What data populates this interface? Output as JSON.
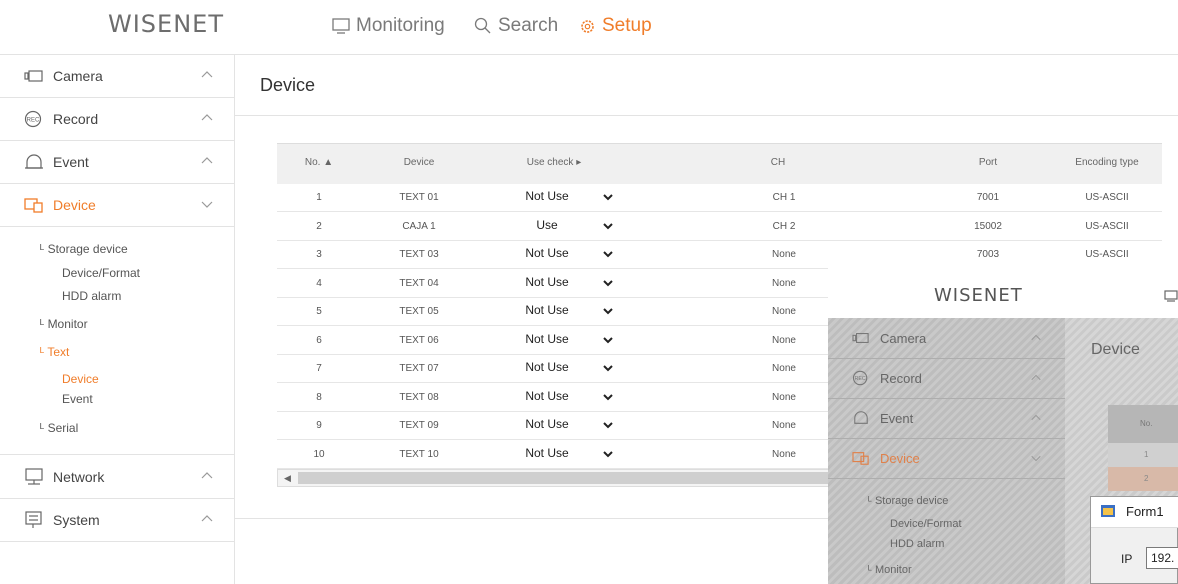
{
  "header": {
    "logo": "WISENET",
    "nav": [
      {
        "label": "Monitoring",
        "icon": "monitor-icon"
      },
      {
        "label": "Search",
        "icon": "search-icon"
      },
      {
        "label": "Setup",
        "icon": "gear-icon"
      }
    ],
    "active_color": "#f07d2a"
  },
  "sidebar": {
    "items": [
      {
        "label": "Camera",
        "icon": "camera-icon"
      },
      {
        "label": "Record",
        "icon": "record-icon"
      },
      {
        "label": "Event",
        "icon": "bell-icon"
      },
      {
        "label": "Device",
        "icon": "device-icon"
      },
      {
        "label": "Network",
        "icon": "network-icon"
      },
      {
        "label": "System",
        "icon": "system-icon"
      }
    ],
    "sub": {
      "storage": "Storage device",
      "device_format": "Device/Format",
      "hdd_alarm": "HDD alarm",
      "monitor": "Monitor",
      "text": "Text",
      "text_device": "Device",
      "text_event": "Event",
      "serial": "Serial"
    }
  },
  "main": {
    "title": "Device",
    "columns": [
      "No.",
      "Device",
      "Use check",
      "CH",
      "Port",
      "Encoding type"
    ],
    "rows": [
      {
        "no": "1",
        "device": "TEXT 01",
        "use": "Not Use",
        "ch": "CH 1",
        "port": "7001",
        "enc": "US-ASCII"
      },
      {
        "no": "2",
        "device": "CAJA 1",
        "use": "Use",
        "ch": "CH 2",
        "port": "15002",
        "enc": "US-ASCII"
      },
      {
        "no": "3",
        "device": "TEXT 03",
        "use": "Not Use",
        "ch": "None",
        "port": "7003",
        "enc": "US-ASCII"
      },
      {
        "no": "4",
        "device": "TEXT 04",
        "use": "Not Use",
        "ch": "None",
        "port": "",
        "enc": ""
      },
      {
        "no": "5",
        "device": "TEXT 05",
        "use": "Not Use",
        "ch": "None",
        "port": "",
        "enc": ""
      },
      {
        "no": "6",
        "device": "TEXT 06",
        "use": "Not Use",
        "ch": "None",
        "port": "",
        "enc": ""
      },
      {
        "no": "7",
        "device": "TEXT 07",
        "use": "Not Use",
        "ch": "None",
        "port": "",
        "enc": ""
      },
      {
        "no": "8",
        "device": "TEXT 08",
        "use": "Not Use",
        "ch": "None",
        "port": "",
        "enc": ""
      },
      {
        "no": "9",
        "device": "TEXT 09",
        "use": "Not Use",
        "ch": "None",
        "port": "",
        "enc": ""
      },
      {
        "no": "10",
        "device": "TEXT 10",
        "use": "Not Use",
        "ch": "None",
        "port": "",
        "enc": ""
      }
    ]
  },
  "overlay": {
    "logo": "WISENET",
    "items": [
      "Camera",
      "Record",
      "Event",
      "Device"
    ],
    "sub": [
      "Storage device",
      "Device/Format",
      "HDD alarm",
      "Monitor"
    ],
    "title": "Device",
    "col_no": "No.",
    "row1_no": "1",
    "row2_no": "2",
    "form_title": "Form1",
    "ip_label": "IP",
    "ip_value": "192."
  }
}
